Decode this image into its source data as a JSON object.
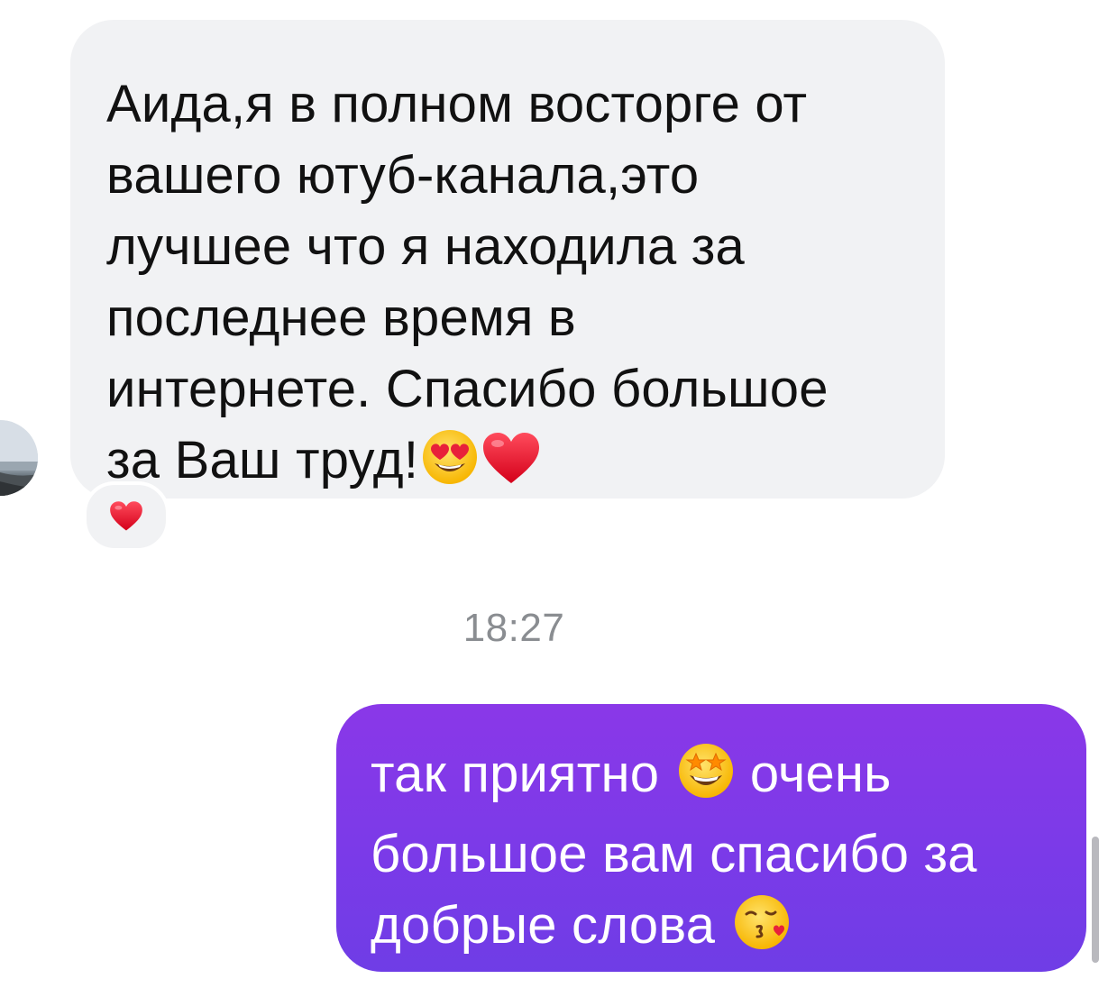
{
  "conversation": {
    "incoming": {
      "lines": [
        "Аида,я в полном восторге от",
        "вашего ютуб-канала,это",
        "лучшее что я находила за",
        "последнее время в",
        "интернете. Спасибо большое",
        "за Ваш труд!"
      ],
      "trailing_emojis": [
        "heart-eyes-emoji",
        "red-heart-emoji"
      ],
      "reaction": "red-heart-emoji",
      "bubble_color": "#f1f2f4",
      "text_color": "#111111"
    },
    "timestamp": "18:27",
    "outgoing": {
      "line1_a": "так приятно",
      "line1_emoji": "star-struck-emoji",
      "line1_b": "очень",
      "line2": "большое вам спасибо за",
      "line3": "добрые слова",
      "line3_emoji": "face-blowing-kiss-emoji",
      "bubble_color": "#7b3ae8",
      "text_color": "#ffffff"
    }
  }
}
